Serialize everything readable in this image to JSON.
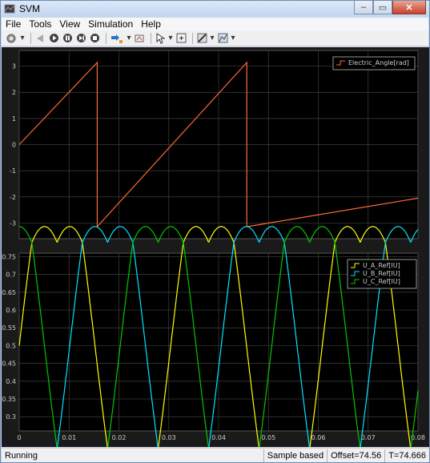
{
  "window": {
    "title": "SVM",
    "controls": {
      "minimize": "–",
      "maximize": "▭",
      "close": "✕"
    }
  },
  "menu": [
    "File",
    "Tools",
    "View",
    "Simulation",
    "Help"
  ],
  "toolbar_icons": [
    "settings-icon",
    "step-back-icon",
    "run-icon",
    "pause-icon",
    "step-forward-icon",
    "stop-icon",
    "highlight-icon",
    "cursor-icon",
    "zoom-icon",
    "style-icon",
    "autoscale-icon"
  ],
  "status": {
    "left": "Running",
    "mode": "Sample based",
    "offset": "Offset=74.56",
    "time": "T=74.666"
  },
  "colors": {
    "plot_bg": "#000000",
    "figure_bg": "#1a1a1a",
    "grid": "#404040",
    "angle": "#ff6a33",
    "u_a": "#ffff00",
    "u_b": "#00e5ff",
    "u_c": "#00c800"
  },
  "chart_data": [
    {
      "type": "line",
      "title": "",
      "xlabel": "",
      "ylabel": "",
      "xlim": [
        0,
        0.08
      ],
      "ylim": [
        -3.6,
        3.6
      ],
      "yticks": [
        "3",
        "2",
        "1",
        "0",
        "-1",
        "-2",
        "-3"
      ],
      "grid": true,
      "legend_position": "top-right",
      "series": [
        {
          "name": "Electric_Angle[rad]",
          "waveform": "sawtooth",
          "range": [
            -3.1416,
            3.1416
          ],
          "x": [
            0,
            0.01565,
            0.01565,
            0.04565,
            0.04565,
            0.08
          ],
          "y": [
            0,
            3.14,
            -3.14,
            3.14,
            -3.14,
            -2.05
          ]
        }
      ]
    },
    {
      "type": "line",
      "title": "",
      "xlabel": "",
      "ylabel": "",
      "xlim": [
        0,
        0.08
      ],
      "ylim": [
        0.26,
        0.76
      ],
      "xticks": [
        "0",
        "0.01",
        "0.02",
        "0.03",
        "0.04",
        "0.05",
        "0.06",
        "0.07",
        "0.08"
      ],
      "yticks": [
        "0.75",
        "0.7",
        "0.65",
        "0.6",
        "0.55",
        "0.5",
        "0.45",
        "0.4",
        "0.35",
        "0.3"
      ],
      "grid": true,
      "legend_position": "top-right",
      "series": [
        {
          "name": "U_A_Ref[IU]",
          "waveform": "svm-reference",
          "period": 0.0304,
          "phase_deg": 0,
          "min": 0.277,
          "max": 0.723
        },
        {
          "name": "U_B_Ref[IU]",
          "waveform": "svm-reference",
          "period": 0.0304,
          "phase_deg": -120,
          "min": 0.277,
          "max": 0.723
        },
        {
          "name": "U_C_Ref[IU]",
          "waveform": "svm-reference",
          "period": 0.0304,
          "phase_deg": 120,
          "min": 0.277,
          "max": 0.723
        }
      ]
    }
  ]
}
